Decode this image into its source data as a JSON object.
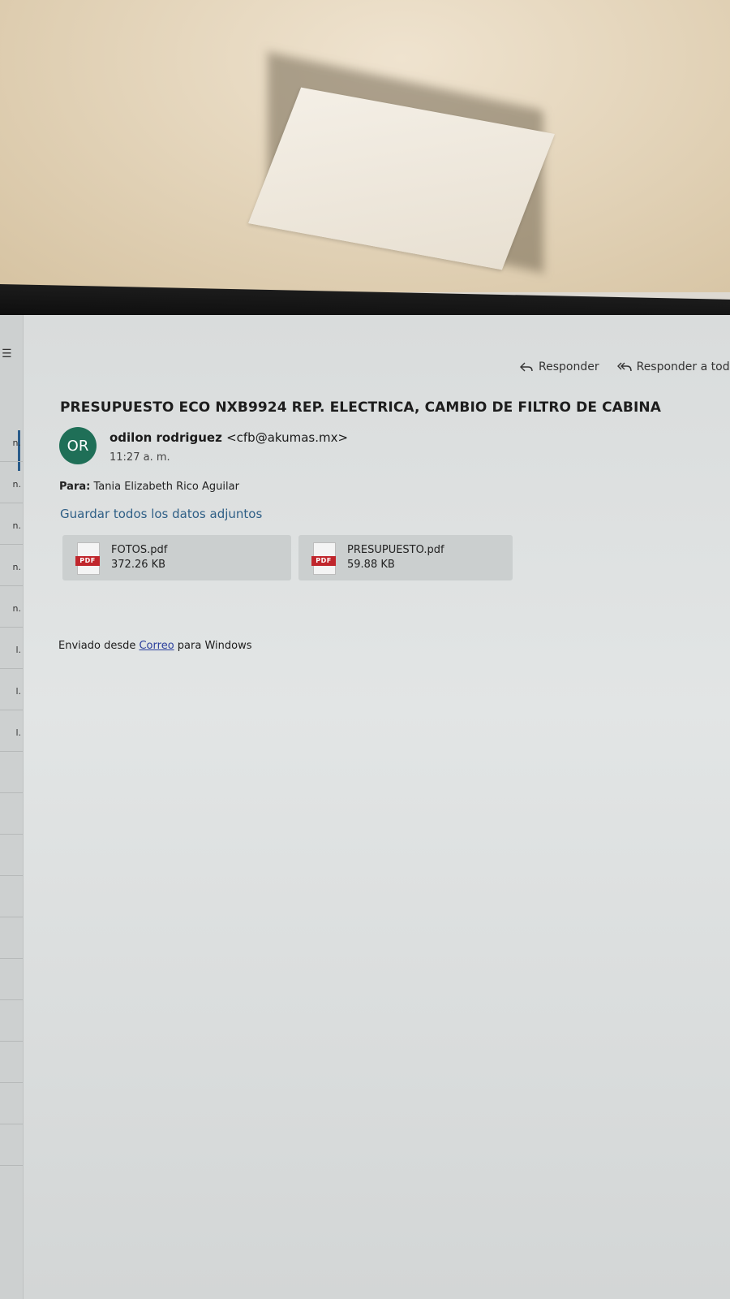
{
  "actions": {
    "reply": "Responder",
    "reply_all": "Responder a todo"
  },
  "message": {
    "subject": "PRESUPUESTO ECO NXB9924 REP. ELECTRICA, CAMBIO DE FILTRO DE CABINA",
    "avatar_initials": "OR",
    "avatar_color": "#1f6f57",
    "sender_name": "odilon rodriguez",
    "sender_email": "<cfb@akumas.mx>",
    "time": "11:27 a. m.",
    "to_label": "Para:",
    "to_name": "Tania Elizabeth Rico Aguilar",
    "save_all": "Guardar todos los datos adjuntos",
    "attachments": [
      {
        "name": "FOTOS.pdf",
        "size": "372.26 KB",
        "icon": "pdf-icon"
      },
      {
        "name": "PRESUPUESTO.pdf",
        "size": "59.88 KB",
        "icon": "pdf-icon"
      }
    ],
    "pdf_tag": "PDF",
    "body": {
      "prefix": "Enviado desde",
      "link": "Correo",
      "suffix": "para Windows"
    }
  },
  "list_strip": {
    "rows": [
      "n.",
      "n.",
      "n.",
      "n.",
      "n.",
      "l.",
      "l.",
      "l."
    ]
  }
}
